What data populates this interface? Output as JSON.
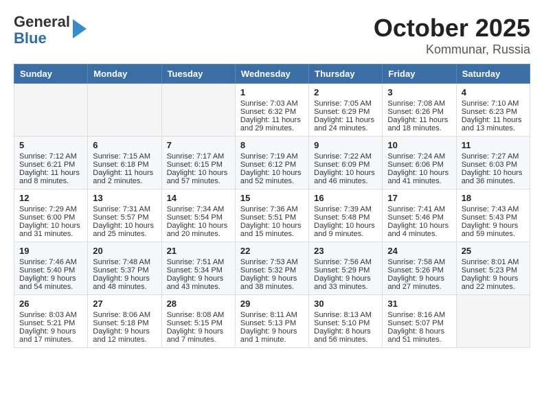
{
  "header": {
    "logo_general": "General",
    "logo_blue": "Blue",
    "title": "October 2025",
    "subtitle": "Kommunar, Russia"
  },
  "days_of_week": [
    "Sunday",
    "Monday",
    "Tuesday",
    "Wednesday",
    "Thursday",
    "Friday",
    "Saturday"
  ],
  "weeks": [
    [
      {
        "day": "",
        "sunrise": "",
        "sunset": "",
        "daylight": "",
        "empty": true
      },
      {
        "day": "",
        "sunrise": "",
        "sunset": "",
        "daylight": "",
        "empty": true
      },
      {
        "day": "",
        "sunrise": "",
        "sunset": "",
        "daylight": "",
        "empty": true
      },
      {
        "day": "1",
        "sunrise": "Sunrise: 7:03 AM",
        "sunset": "Sunset: 6:32 PM",
        "daylight": "Daylight: 11 hours and 29 minutes."
      },
      {
        "day": "2",
        "sunrise": "Sunrise: 7:05 AM",
        "sunset": "Sunset: 6:29 PM",
        "daylight": "Daylight: 11 hours and 24 minutes."
      },
      {
        "day": "3",
        "sunrise": "Sunrise: 7:08 AM",
        "sunset": "Sunset: 6:26 PM",
        "daylight": "Daylight: 11 hours and 18 minutes."
      },
      {
        "day": "4",
        "sunrise": "Sunrise: 7:10 AM",
        "sunset": "Sunset: 6:23 PM",
        "daylight": "Daylight: 11 hours and 13 minutes."
      }
    ],
    [
      {
        "day": "5",
        "sunrise": "Sunrise: 7:12 AM",
        "sunset": "Sunset: 6:21 PM",
        "daylight": "Daylight: 11 hours and 8 minutes."
      },
      {
        "day": "6",
        "sunrise": "Sunrise: 7:15 AM",
        "sunset": "Sunset: 6:18 PM",
        "daylight": "Daylight: 11 hours and 2 minutes."
      },
      {
        "day": "7",
        "sunrise": "Sunrise: 7:17 AM",
        "sunset": "Sunset: 6:15 PM",
        "daylight": "Daylight: 10 hours and 57 minutes."
      },
      {
        "day": "8",
        "sunrise": "Sunrise: 7:19 AM",
        "sunset": "Sunset: 6:12 PM",
        "daylight": "Daylight: 10 hours and 52 minutes."
      },
      {
        "day": "9",
        "sunrise": "Sunrise: 7:22 AM",
        "sunset": "Sunset: 6:09 PM",
        "daylight": "Daylight: 10 hours and 46 minutes."
      },
      {
        "day": "10",
        "sunrise": "Sunrise: 7:24 AM",
        "sunset": "Sunset: 6:06 PM",
        "daylight": "Daylight: 10 hours and 41 minutes."
      },
      {
        "day": "11",
        "sunrise": "Sunrise: 7:27 AM",
        "sunset": "Sunset: 6:03 PM",
        "daylight": "Daylight: 10 hours and 36 minutes."
      }
    ],
    [
      {
        "day": "12",
        "sunrise": "Sunrise: 7:29 AM",
        "sunset": "Sunset: 6:00 PM",
        "daylight": "Daylight: 10 hours and 31 minutes."
      },
      {
        "day": "13",
        "sunrise": "Sunrise: 7:31 AM",
        "sunset": "Sunset: 5:57 PM",
        "daylight": "Daylight: 10 hours and 25 minutes."
      },
      {
        "day": "14",
        "sunrise": "Sunrise: 7:34 AM",
        "sunset": "Sunset: 5:54 PM",
        "daylight": "Daylight: 10 hours and 20 minutes."
      },
      {
        "day": "15",
        "sunrise": "Sunrise: 7:36 AM",
        "sunset": "Sunset: 5:51 PM",
        "daylight": "Daylight: 10 hours and 15 minutes."
      },
      {
        "day": "16",
        "sunrise": "Sunrise: 7:39 AM",
        "sunset": "Sunset: 5:48 PM",
        "daylight": "Daylight: 10 hours and 9 minutes."
      },
      {
        "day": "17",
        "sunrise": "Sunrise: 7:41 AM",
        "sunset": "Sunset: 5:46 PM",
        "daylight": "Daylight: 10 hours and 4 minutes."
      },
      {
        "day": "18",
        "sunrise": "Sunrise: 7:43 AM",
        "sunset": "Sunset: 5:43 PM",
        "daylight": "Daylight: 9 hours and 59 minutes."
      }
    ],
    [
      {
        "day": "19",
        "sunrise": "Sunrise: 7:46 AM",
        "sunset": "Sunset: 5:40 PM",
        "daylight": "Daylight: 9 hours and 54 minutes."
      },
      {
        "day": "20",
        "sunrise": "Sunrise: 7:48 AM",
        "sunset": "Sunset: 5:37 PM",
        "daylight": "Daylight: 9 hours and 48 minutes."
      },
      {
        "day": "21",
        "sunrise": "Sunrise: 7:51 AM",
        "sunset": "Sunset: 5:34 PM",
        "daylight": "Daylight: 9 hours and 43 minutes."
      },
      {
        "day": "22",
        "sunrise": "Sunrise: 7:53 AM",
        "sunset": "Sunset: 5:32 PM",
        "daylight": "Daylight: 9 hours and 38 minutes."
      },
      {
        "day": "23",
        "sunrise": "Sunrise: 7:56 AM",
        "sunset": "Sunset: 5:29 PM",
        "daylight": "Daylight: 9 hours and 33 minutes."
      },
      {
        "day": "24",
        "sunrise": "Sunrise: 7:58 AM",
        "sunset": "Sunset: 5:26 PM",
        "daylight": "Daylight: 9 hours and 27 minutes."
      },
      {
        "day": "25",
        "sunrise": "Sunrise: 8:01 AM",
        "sunset": "Sunset: 5:23 PM",
        "daylight": "Daylight: 9 hours and 22 minutes."
      }
    ],
    [
      {
        "day": "26",
        "sunrise": "Sunrise: 8:03 AM",
        "sunset": "Sunset: 5:21 PM",
        "daylight": "Daylight: 9 hours and 17 minutes."
      },
      {
        "day": "27",
        "sunrise": "Sunrise: 8:06 AM",
        "sunset": "Sunset: 5:18 PM",
        "daylight": "Daylight: 9 hours and 12 minutes."
      },
      {
        "day": "28",
        "sunrise": "Sunrise: 8:08 AM",
        "sunset": "Sunset: 5:15 PM",
        "daylight": "Daylight: 9 hours and 7 minutes."
      },
      {
        "day": "29",
        "sunrise": "Sunrise: 8:11 AM",
        "sunset": "Sunset: 5:13 PM",
        "daylight": "Daylight: 9 hours and 1 minute."
      },
      {
        "day": "30",
        "sunrise": "Sunrise: 8:13 AM",
        "sunset": "Sunset: 5:10 PM",
        "daylight": "Daylight: 8 hours and 56 minutes."
      },
      {
        "day": "31",
        "sunrise": "Sunrise: 8:16 AM",
        "sunset": "Sunset: 5:07 PM",
        "daylight": "Daylight: 8 hours and 51 minutes."
      },
      {
        "day": "",
        "sunrise": "",
        "sunset": "",
        "daylight": "",
        "empty": true
      }
    ]
  ]
}
